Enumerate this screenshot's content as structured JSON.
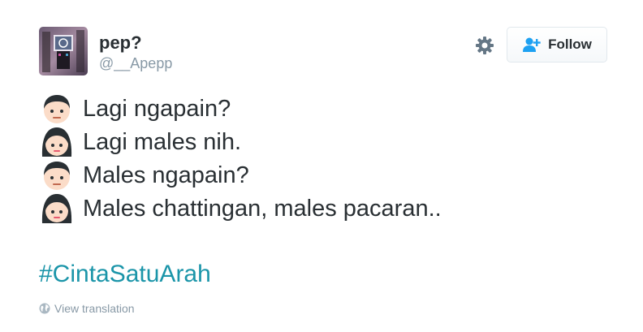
{
  "author": {
    "display_name": "pep?",
    "handle": "@__Apepp"
  },
  "actions": {
    "follow_label": "Follow"
  },
  "tweet": {
    "lines": [
      {
        "speaker": "boy-emoji",
        "text": "Lagi ngapain?"
      },
      {
        "speaker": "girl-emoji",
        "text": "Lagi males nih."
      },
      {
        "speaker": "boy-emoji",
        "text": "Males ngapain?"
      },
      {
        "speaker": "girl-emoji",
        "text": "Males chattingan, males pacaran.."
      }
    ],
    "hashtag": "#CintaSatuArah",
    "translate_label": "View translation"
  },
  "colors": {
    "hashtag": "#1b95a9",
    "muted": "#8899a6",
    "follow_icon": "#1da1f2"
  }
}
